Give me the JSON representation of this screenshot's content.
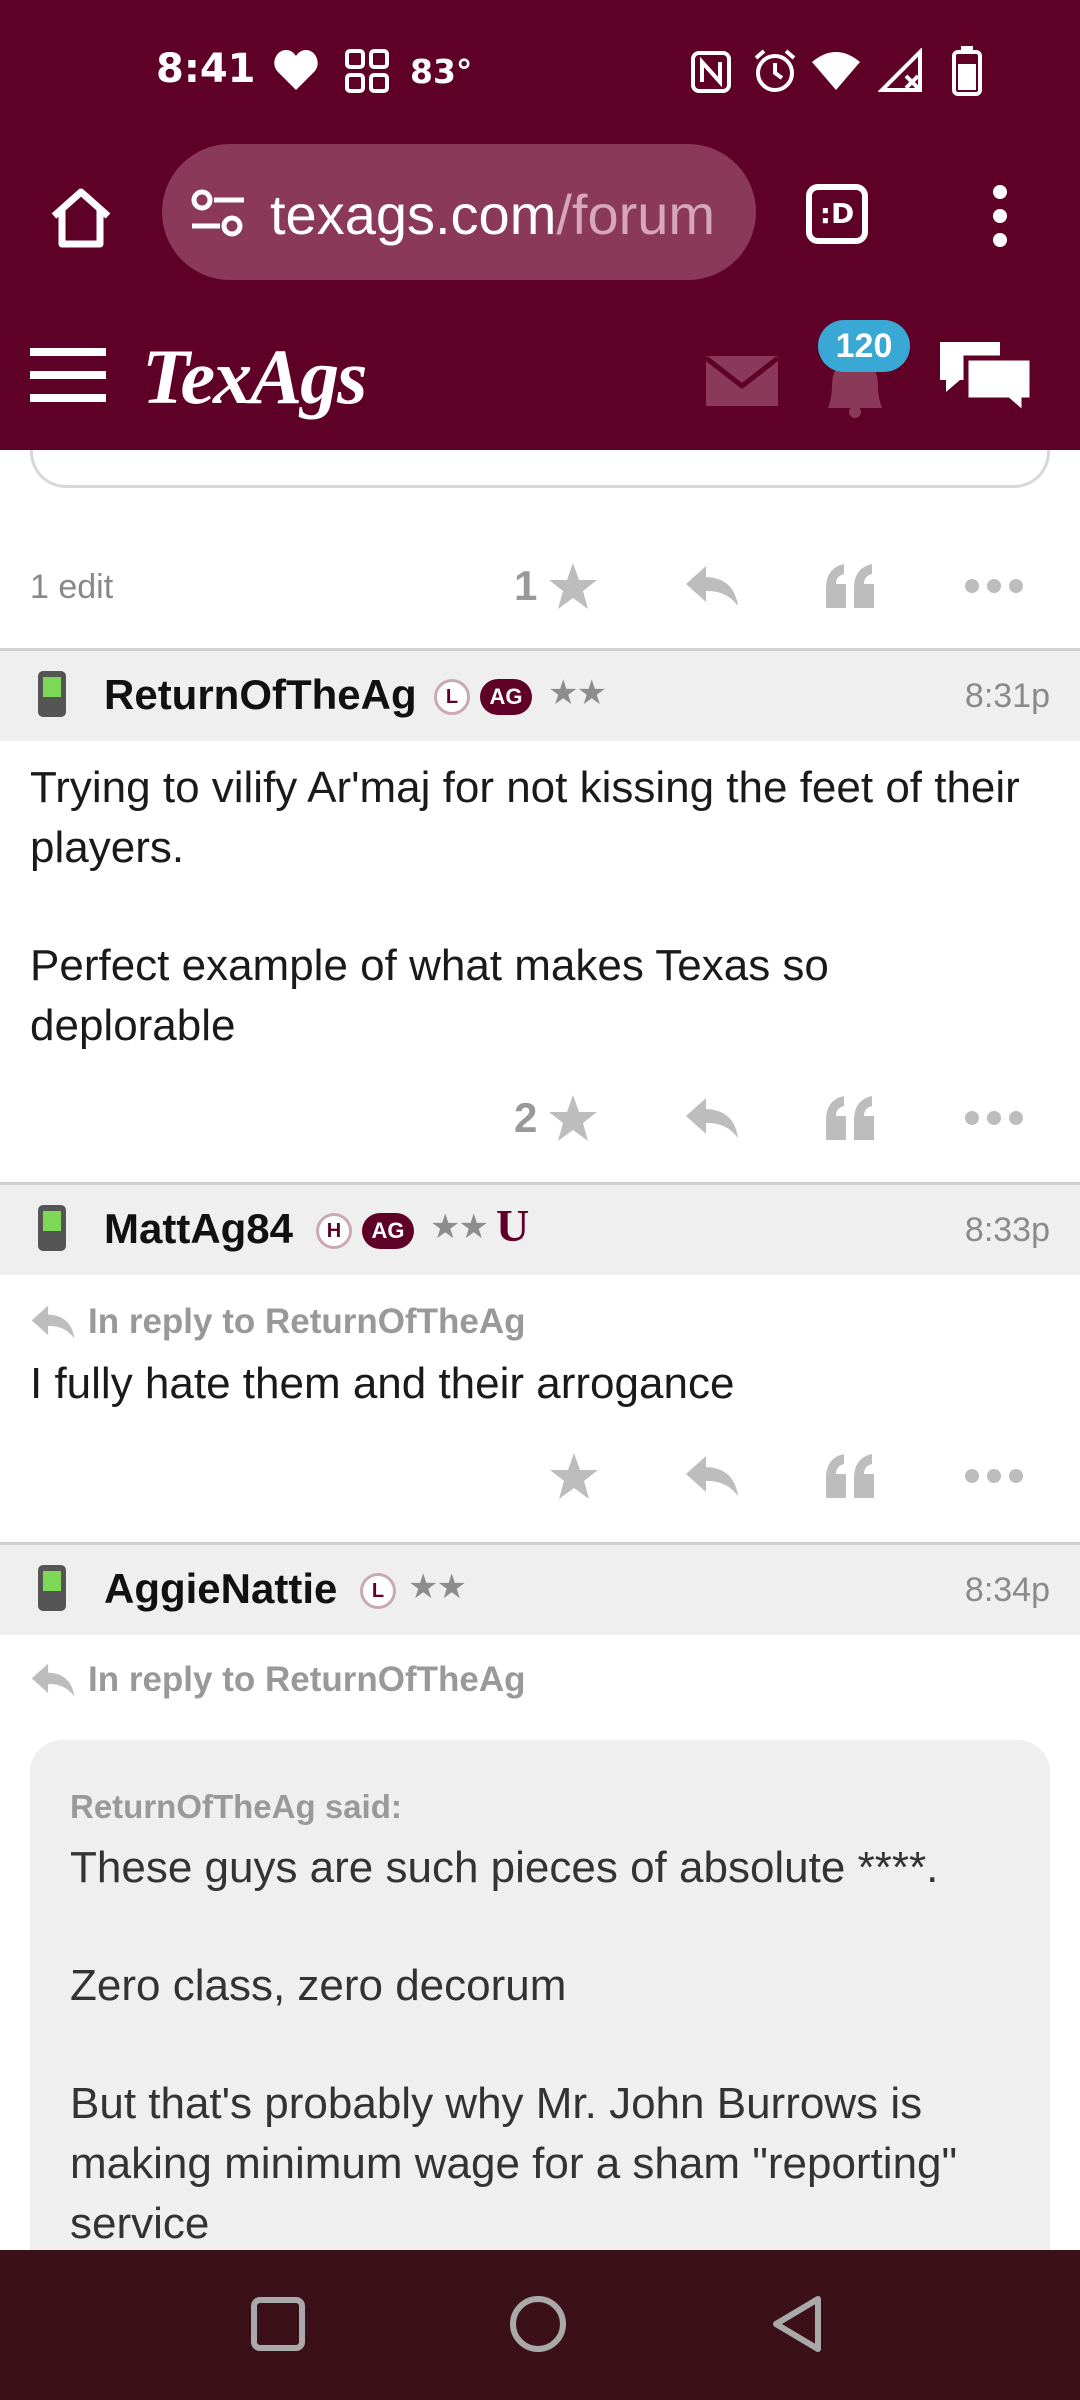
{
  "colors": {
    "brand": "#5f0026",
    "brand_light": "#8a3a58",
    "notif_badge": "#3aa8d4",
    "nav_bg": "#3c1019"
  },
  "status_bar": {
    "time": "8:41",
    "temperature": "83°",
    "icons": [
      "heart-icon",
      "widgets-icon",
      "nfc-icon",
      "alarm-icon",
      "wifi-icon",
      "signal-icon",
      "battery-icon"
    ]
  },
  "browser": {
    "url_host": "texags.com",
    "url_path": "/forum",
    "tab_icon_label": ":D",
    "icons": [
      "home-icon",
      "site-settings-icon",
      "tab-switcher-icon",
      "more-vertical-icon"
    ]
  },
  "site_header": {
    "logo": "TexAgs",
    "notification_count": "120",
    "icons": [
      "menu-icon",
      "mail-icon",
      "bell-icon",
      "chat-icon"
    ]
  },
  "prev_post": {
    "edit_label": "1 edit",
    "star_count": "1"
  },
  "posts": [
    {
      "username": "ReturnOfTheAg",
      "badges": [
        "L",
        "AG"
      ],
      "stars": "★★",
      "time": "8:31p",
      "body": [
        "Trying to vilify Ar'maj for not kissing the feet of their players.",
        "Perfect example of what makes Texas so deplorable"
      ],
      "star_count": "2"
    },
    {
      "username": "MattAg84",
      "badges": [
        "H",
        "AG"
      ],
      "stars": "★★",
      "extra_badge": "U",
      "time": "8:33p",
      "reply_to": "In reply to ReturnOfTheAg",
      "body": [
        "I fully hate them and their arrogance"
      ],
      "star_count": ""
    },
    {
      "username": "AggieNattie",
      "badges": [
        "L"
      ],
      "stars": "★★",
      "time": "8:34p",
      "reply_to": "In reply to ReturnOfTheAg",
      "quote": {
        "attribution": "ReturnOfTheAg said:",
        "lines": [
          "These guys are such pieces of absolute ****.",
          "Zero class, zero decorum",
          "But that's probably why Mr. John Burrows is making minimum wage for a sham \"reporting\" service"
        ]
      }
    }
  ],
  "nav_bar": {
    "icons": [
      "recents-square-icon",
      "home-circle-icon",
      "back-triangle-icon"
    ]
  }
}
